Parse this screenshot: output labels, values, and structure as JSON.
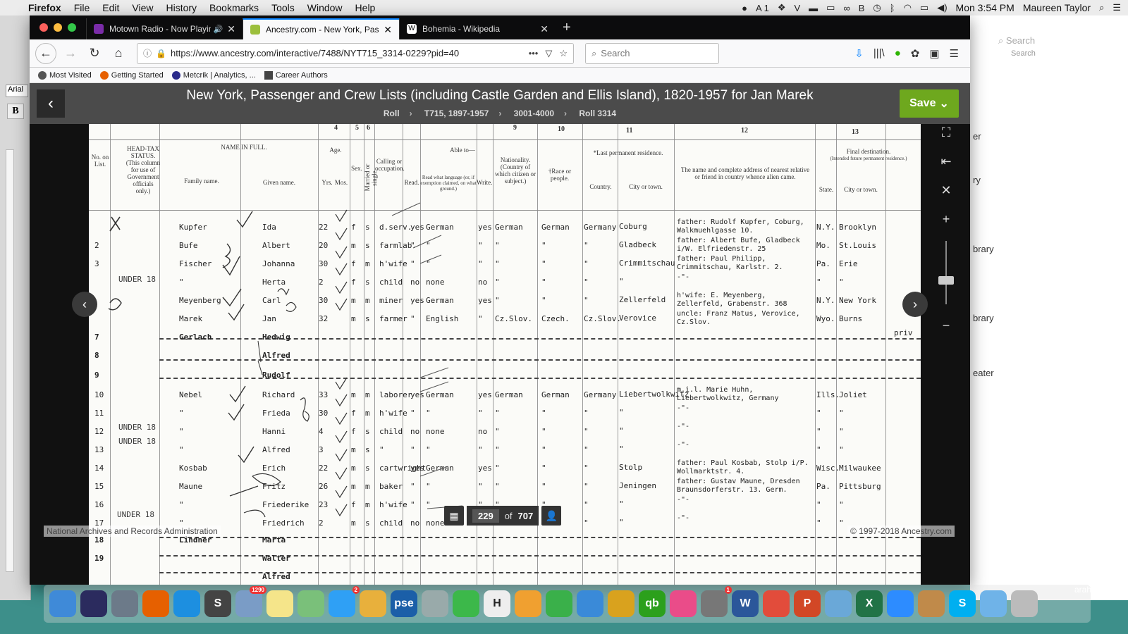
{
  "menubar": {
    "app": "Firefox",
    "items": [
      "File",
      "Edit",
      "View",
      "History",
      "Bookmarks",
      "Tools",
      "Window",
      "Help"
    ],
    "status_icons": [
      "messages-icon",
      "adobe-icon",
      "dropbox-icon",
      "v-icon",
      "battery-icon",
      "display-icon",
      "link-icon",
      "b-icon",
      "timemachine-icon",
      "bluetooth-icon",
      "wifi-icon",
      "airplay-icon",
      "volume-icon"
    ],
    "adobe_count": "1",
    "clock": "Mon 3:54 PM",
    "user": "Maureen Taylor"
  },
  "tabs": [
    {
      "title": "Motown Radio - Now Playing",
      "favicon_color": "#7a2ca8",
      "audio": true
    },
    {
      "title": "Ancestry.com - New York, Passe",
      "favicon_color": "#9cbf3c",
      "active": true
    },
    {
      "title": "Bohemia - Wikipedia",
      "favicon_color": "#ffffff",
      "favicon_char": "W"
    }
  ],
  "navbar": {
    "url": "https://www.ancestry.com/interactive/7488/NYT715_3314-0229?pid=40",
    "search_placeholder": "Search"
  },
  "bookmarks": [
    {
      "label": "Most Visited",
      "color": "#555"
    },
    {
      "label": "Getting Started",
      "color": "#e66000"
    },
    {
      "label": "Metcrik | Analytics, ...",
      "color": "#2a2a8a"
    },
    {
      "label": "Career Authors",
      "color": "#444"
    }
  ],
  "viewer": {
    "title": "New York, Passenger and Crew Lists (including Castle Garden and Ellis Island), 1820-1957 for Jan Marek",
    "breadcrumbs": [
      "Roll",
      "T715, 1897-1957",
      "3001-4000",
      "Roll 3314"
    ],
    "save_label": "Save",
    "page_current": "229",
    "page_of": "of",
    "page_total": "707",
    "source": "National Archives and Records Administration",
    "copyright": "© 1997-2018 Ancestry.com"
  },
  "document": {
    "column_numbers": [
      "1",
      "2",
      "3",
      "4",
      "5",
      "6",
      "7",
      "8",
      "9",
      "10",
      "11",
      "12",
      "13"
    ],
    "headers": {
      "no": "No. on List.",
      "headtax": "HEAD-TAX STATUS. (This column for use of Government officials only.)",
      "name_full": "NAME IN FULL.",
      "family": "Family name.",
      "given": "Given name.",
      "age": "Age.",
      "yrs": "Yrs.",
      "mos": "Mos.",
      "sex": "Sex.",
      "married": "Married or single.",
      "calling": "Calling or occupation.",
      "able": "Able to—",
      "read": "Read.",
      "readlang": "Read what language (or, if exemption claimed, on what ground.)",
      "write": "Write.",
      "nationality": "Nationality. (Country of which citizen or subject.)",
      "race": "†Race or people.",
      "lastres": "*Last permanent residence.",
      "country": "Country.",
      "city": "City or town.",
      "relative": "The name and complete address of nearest relative or friend in country whence alien came.",
      "finaldest": "Final destination.",
      "finaldest_sub": "(Intended future permanent residence.)",
      "state": "State.",
      "dcity": "City or town."
    },
    "rows": [
      {
        "no": "",
        "family": "Kupfer",
        "given": "Ida",
        "age": "22",
        "sex": "f",
        "ms": "s",
        "occ": "d.serv.",
        "read": "yes",
        "lang": "German",
        "write": "yes",
        "nat": "German",
        "race": "German",
        "country": "Germany",
        "city": "Coburg",
        "relative": "father: Rudolf Kupfer, Coburg, Walkmuehlgasse 10.",
        "state": "N.Y.",
        "dcity": "Brooklyn"
      },
      {
        "no": "2",
        "family": "Bufe",
        "given": "Albert",
        "age": "20",
        "sex": "m",
        "ms": "s",
        "occ": "farmlab.",
        "read": "\"",
        "lang": "\"",
        "write": "\"",
        "nat": "\"",
        "race": "\"",
        "country": "\"",
        "city": "Gladbeck",
        "relative": "father: Albert Bufe, Gladbeck i/W. Elfriedenstr. 25",
        "state": "Mo.",
        "dcity": "St.Louis"
      },
      {
        "no": "3",
        "family": "Fischer",
        "given": "Johanna",
        "age": "30",
        "sex": "f",
        "ms": "m",
        "occ": "h'wife",
        "read": "\"",
        "lang": "\"",
        "write": "\"",
        "nat": "\"",
        "race": "\"",
        "country": "\"",
        "city": "Crimmitschau",
        "relative": "father: Paul Philipp, Crimmitschau, Karlstr. 2.",
        "state": "Pa.",
        "dcity": "Erie"
      },
      {
        "no": "",
        "family": "\"",
        "given": "Herta",
        "age": "2",
        "sex": "f",
        "ms": "s",
        "occ": "child",
        "read": "no",
        "lang": "none",
        "write": "no",
        "nat": "\"",
        "race": "\"",
        "country": "\"",
        "city": "\"",
        "relative": "-\"-",
        "state": "\"",
        "dcity": "\""
      },
      {
        "no": "",
        "family": "Meyenberg",
        "given": "Carl",
        "age": "30",
        "sex": "m",
        "ms": "m",
        "occ": "miner",
        "read": "yes",
        "lang": "German",
        "write": "yes",
        "nat": "\"",
        "race": "\"",
        "country": "\"",
        "city": "Zellerfeld",
        "relative": "h'wife: E. Meyenberg, Zellerfeld, Grabenstr. 368",
        "state": "N.Y.",
        "dcity": "New York"
      },
      {
        "no": "",
        "family": "Marek",
        "given": "Jan",
        "age": "32",
        "sex": "m",
        "ms": "s",
        "occ": "farmer",
        "read": "\"",
        "lang": "English",
        "write": "\"",
        "nat": "Cz.Slov.",
        "race": "Czech.",
        "country": "Cz.Slov.",
        "city": "Verovice",
        "relative": "uncle: Franz Matus, Verovice, Cz.Slov.",
        "state": "Wyo.",
        "dcity": "Burns"
      },
      {
        "no": "7",
        "family": "Gerlach",
        "given": "Hedwig",
        "cancelled": true
      },
      {
        "no": "8",
        "family": "",
        "given": "Alfred",
        "cancelled": true
      },
      {
        "no": "9",
        "family": "",
        "given": "Rudolf",
        "cancelled": true
      },
      {
        "no": "10",
        "family": "Nebel",
        "given": "Richard",
        "age": "33",
        "sex": "m",
        "ms": "m",
        "occ": "laborer",
        "read": "yes",
        "lang": "German",
        "write": "yes",
        "nat": "German",
        "race": "German",
        "country": "Germany",
        "city": "Liebertwolkwitz",
        "relative": "m.i.l. Marie Huhn, Liebertwolkwitz, Germany",
        "state": "Ills.",
        "dcity": "Joliet"
      },
      {
        "no": "11",
        "family": "\"",
        "given": "Frieda",
        "age": "30",
        "sex": "f",
        "ms": "m",
        "occ": "h'wife",
        "read": "\"",
        "lang": "\"",
        "write": "\"",
        "nat": "\"",
        "race": "\"",
        "country": "\"",
        "city": "\"",
        "relative": "-\"-",
        "state": "\"",
        "dcity": "\""
      },
      {
        "no": "12",
        "family": "\"",
        "given": "Hanni",
        "age": "4",
        "sex": "f",
        "ms": "s",
        "occ": "child",
        "read": "no",
        "lang": "none",
        "write": "no",
        "nat": "\"",
        "race": "\"",
        "country": "\"",
        "city": "\"",
        "relative": "-\"-",
        "state": "\"",
        "dcity": "\""
      },
      {
        "no": "13",
        "family": "\"",
        "given": "Alfred",
        "age": "3",
        "sex": "m",
        "ms": "s",
        "occ": "\"",
        "read": "\"",
        "lang": "\"",
        "write": "\"",
        "nat": "\"",
        "race": "\"",
        "country": "\"",
        "city": "\"",
        "relative": "-\"-",
        "state": "\"",
        "dcity": "\""
      },
      {
        "no": "14",
        "family": "Kosbab",
        "given": "Erich",
        "age": "22",
        "sex": "m",
        "ms": "s",
        "occ": "cartwright",
        "read": "yes",
        "lang": "German",
        "write": "yes",
        "nat": "\"",
        "race": "\"",
        "country": "\"",
        "city": "Stolp",
        "relative": "father: Paul Kosbab, Stolp i/P. Wollmarktstr. 4.",
        "state": "Wisc.",
        "dcity": "Milwaukee"
      },
      {
        "no": "15",
        "family": "Maune",
        "given": "Fritz",
        "age": "26",
        "sex": "m",
        "ms": "m",
        "occ": "baker",
        "read": "\"",
        "lang": "\"",
        "write": "\"",
        "nat": "\"",
        "race": "\"",
        "country": "\"",
        "city": "Jeningen",
        "relative": "father: Gustav Maune, Dresden Braunsdorferstr. 13. Germ.",
        "state": "Pa.",
        "dcity": "Pittsburg"
      },
      {
        "no": "16",
        "family": "\"",
        "given": "Friederike",
        "age": "23",
        "sex": "f",
        "ms": "m",
        "occ": "h'wife",
        "read": "\"",
        "lang": "\"",
        "write": "\"",
        "nat": "\"",
        "race": "\"",
        "country": "\"",
        "city": "\"",
        "relative": "-\"-",
        "state": "\"",
        "dcity": "\""
      },
      {
        "no": "17",
        "family": "\"",
        "given": "Friedrich",
        "age": "2",
        "sex": "m",
        "ms": "s",
        "occ": "child",
        "read": "no",
        "lang": "none",
        "write": "no",
        "nat": "\"",
        "race": "\"",
        "country": "\"",
        "city": "\"",
        "relative": "-\"-",
        "state": "\"",
        "dcity": "\""
      },
      {
        "no": "18",
        "family": "Lindner",
        "given": "Marta",
        "cancelled": true
      },
      {
        "no": "19",
        "family": "",
        "given": "Walter",
        "cancelled": true
      },
      {
        "no": "",
        "family": "",
        "given": "Alfred",
        "cancelled": true
      }
    ],
    "annotations": {
      "under18_1": "UNDER 18",
      "under18_2": "UNDER 18",
      "under18_3": "UNDER 18",
      "under18_4": "UNDER 18",
      "priv": "priv"
    }
  },
  "background": {
    "left_font": "Arial",
    "left_bold": "B",
    "right_search": "Search",
    "right_search_sub": "Search",
    "right_labels": [
      "er",
      "ry",
      "brary",
      "brary",
      "eater"
    ],
    "desktop_file": "arah son.png"
  },
  "dock": [
    {
      "name": "finder-icon",
      "color": "#3f8ad8",
      "char": ""
    },
    {
      "name": "siri-icon",
      "color": "#2b2b5e",
      "char": ""
    },
    {
      "name": "launchpad-icon",
      "color": "#6c7a89",
      "char": ""
    },
    {
      "name": "firefox-icon",
      "color": "#e66000",
      "char": ""
    },
    {
      "name": "safari-icon",
      "color": "#1d8fe0",
      "char": ""
    },
    {
      "name": "scrivener-icon",
      "color": "#444",
      "char": "S"
    },
    {
      "name": "preview-icon",
      "color": "#7a9cc6",
      "char": "",
      "badge": "1290"
    },
    {
      "name": "notes-icon",
      "color": "#f5e58a",
      "char": ""
    },
    {
      "name": "maps-icon",
      "color": "#7ac07a",
      "char": ""
    },
    {
      "name": "messages-icon",
      "color": "#2fa0f5",
      "char": "",
      "badge": "2"
    },
    {
      "name": "photos-icon",
      "color": "#e8b03c",
      "char": ""
    },
    {
      "name": "pse-icon",
      "color": "#1b5fa8",
      "char": "pse"
    },
    {
      "name": "scanner-icon",
      "color": "#9aa",
      "char": ""
    },
    {
      "name": "facetime-icon",
      "color": "#3cb84a",
      "char": ""
    },
    {
      "name": "heritage-icon",
      "color": "#eee",
      "char": "H"
    },
    {
      "name": "pages-icon",
      "color": "#f0a030",
      "char": ""
    },
    {
      "name": "numbers-icon",
      "color": "#3ab04a",
      "char": ""
    },
    {
      "name": "keynote-icon",
      "color": "#3a8ad8",
      "char": ""
    },
    {
      "name": "chrome-icon",
      "color": "#d9a21e",
      "char": ""
    },
    {
      "name": "quickbooks-icon",
      "color": "#2ca01c",
      "char": "qb"
    },
    {
      "name": "itunes-icon",
      "color": "#ea4c89",
      "char": ""
    },
    {
      "name": "systemprefs-icon",
      "color": "#777",
      "char": "",
      "badge": "1"
    },
    {
      "name": "word-icon",
      "color": "#2b579a",
      "char": "W"
    },
    {
      "name": "chart-app-icon",
      "color": "#e24c3b",
      "char": ""
    },
    {
      "name": "powerpoint-icon",
      "color": "#d24726",
      "char": "P"
    },
    {
      "name": "drive-icon",
      "color": "#6aa8d8",
      "char": ""
    },
    {
      "name": "excel-icon",
      "color": "#217346",
      "char": "X"
    },
    {
      "name": "zoom-icon",
      "color": "#2d8cff",
      "char": ""
    },
    {
      "name": "ancestry-app-icon",
      "color": "#c08a4a",
      "char": ""
    },
    {
      "name": "skype-icon",
      "color": "#00aff0",
      "char": "S"
    },
    {
      "name": "downloads-folder-icon",
      "color": "#6fb3e8",
      "char": ""
    },
    {
      "name": "trash-icon",
      "color": "#bbb",
      "char": ""
    }
  ]
}
